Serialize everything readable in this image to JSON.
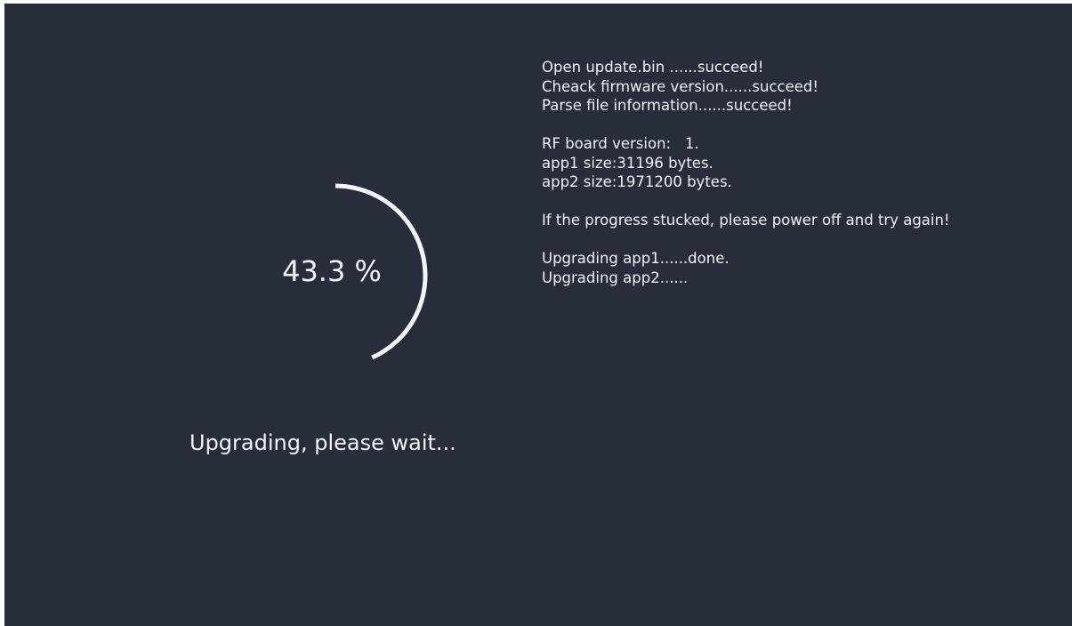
{
  "progress": {
    "percent_label": "43.3 %",
    "fraction": 0.433,
    "ring_color": "#f4f5f7"
  },
  "status": {
    "message": "Upgrading, please wait..."
  },
  "log": {
    "lines": [
      "Open update.bin ......succeed!",
      "Cheack firmware version......succeed!",
      "Parse file information......succeed!",
      "",
      "RF board version:   1.",
      "app1 size:31196 bytes.",
      "app2 size:1971200 bytes.",
      "",
      "If the progress stucked, please power off and try again!",
      "",
      "Upgrading app1......done.",
      "Upgrading app2......"
    ]
  },
  "colors": {
    "background": "#282d3c",
    "text": "#f2f3f5"
  }
}
